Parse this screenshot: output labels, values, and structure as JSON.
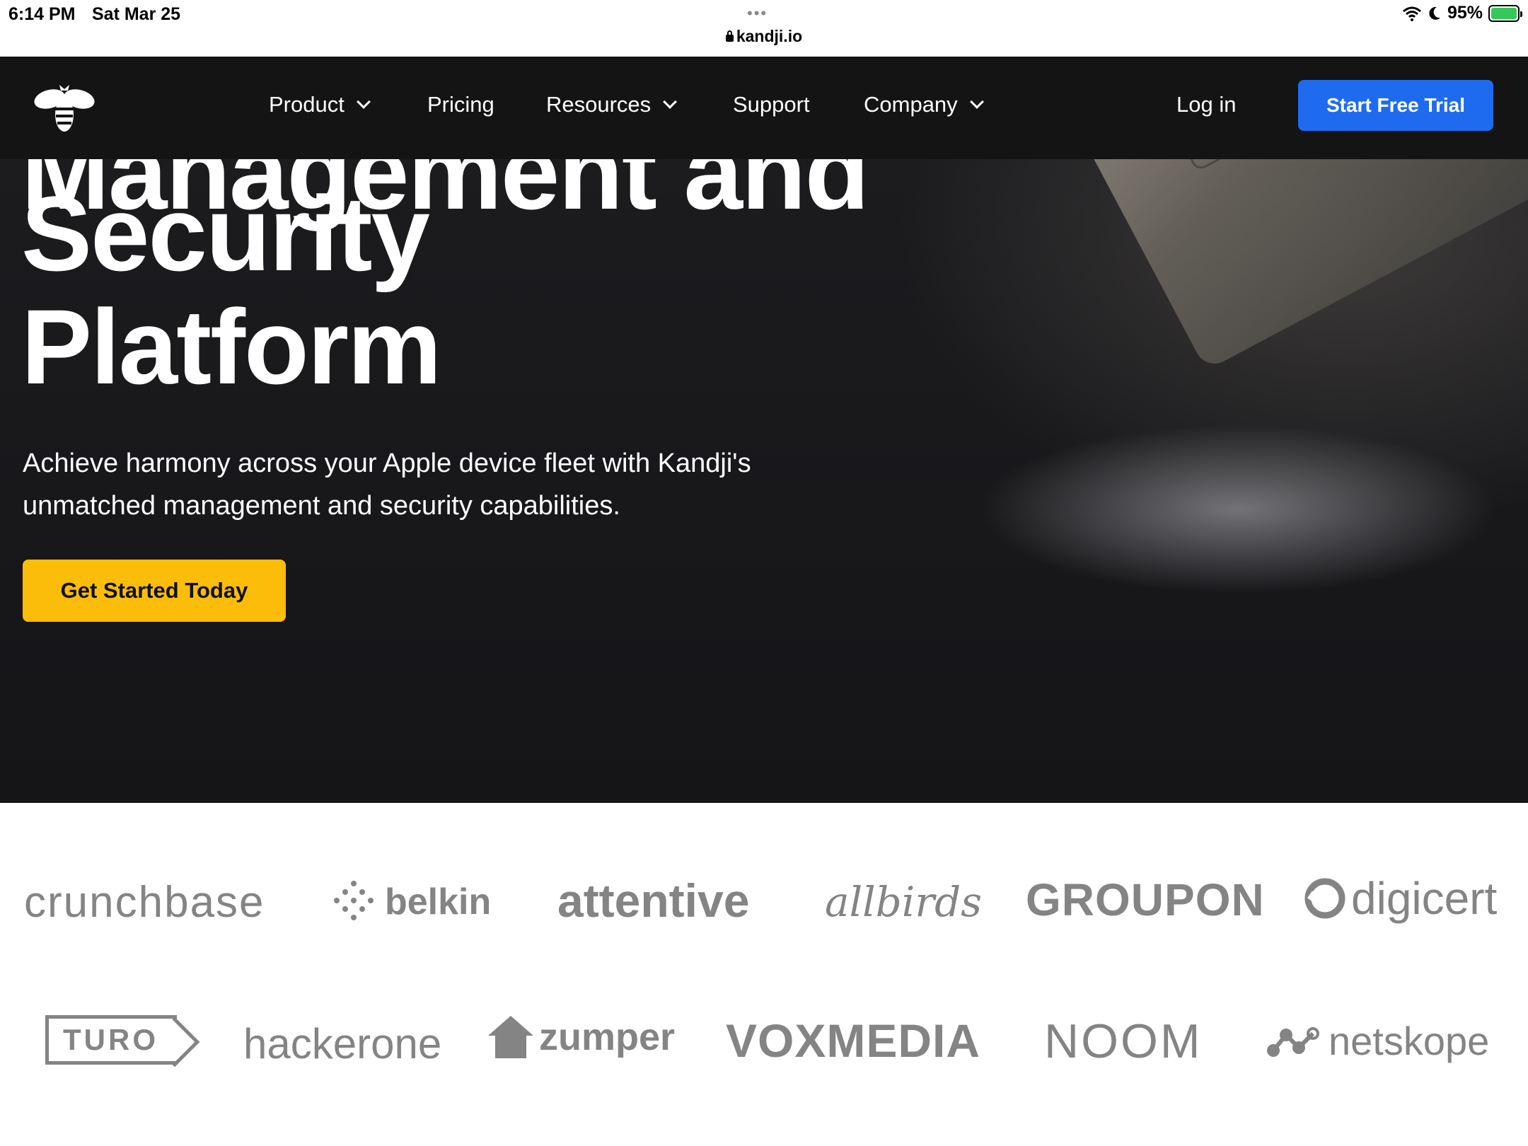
{
  "status_bar": {
    "time": "6:14 PM",
    "date": "Sat Mar 25",
    "dots": "•••",
    "url": "kandji.io",
    "battery": "95%"
  },
  "nav": {
    "items": [
      {
        "label": "Product",
        "has_dropdown": true
      },
      {
        "label": "Pricing",
        "has_dropdown": false
      },
      {
        "label": "Resources",
        "has_dropdown": true
      },
      {
        "label": "Support",
        "has_dropdown": false
      },
      {
        "label": "Company",
        "has_dropdown": true
      }
    ],
    "login": "Log in",
    "cta": "Start Free Trial",
    "cta_color": "#1f6bf0"
  },
  "hero": {
    "headline_partial": "Management and",
    "headline_line1": "Security",
    "headline_line2": "Platform",
    "subhead": "Achieve harmony across your Apple device fleet with Kandji's unmatched management and security capabilities.",
    "cta": "Get Started Today",
    "cta_color": "#fbbd0a"
  },
  "customers": {
    "logos": [
      "crunchbase",
      "belkin",
      "attentive",
      "allbirds",
      "GROUPON",
      "digicert",
      "TURO",
      "hackerone",
      "zumper",
      "VOXMEDIA",
      "NOOM",
      "netskope"
    ]
  }
}
